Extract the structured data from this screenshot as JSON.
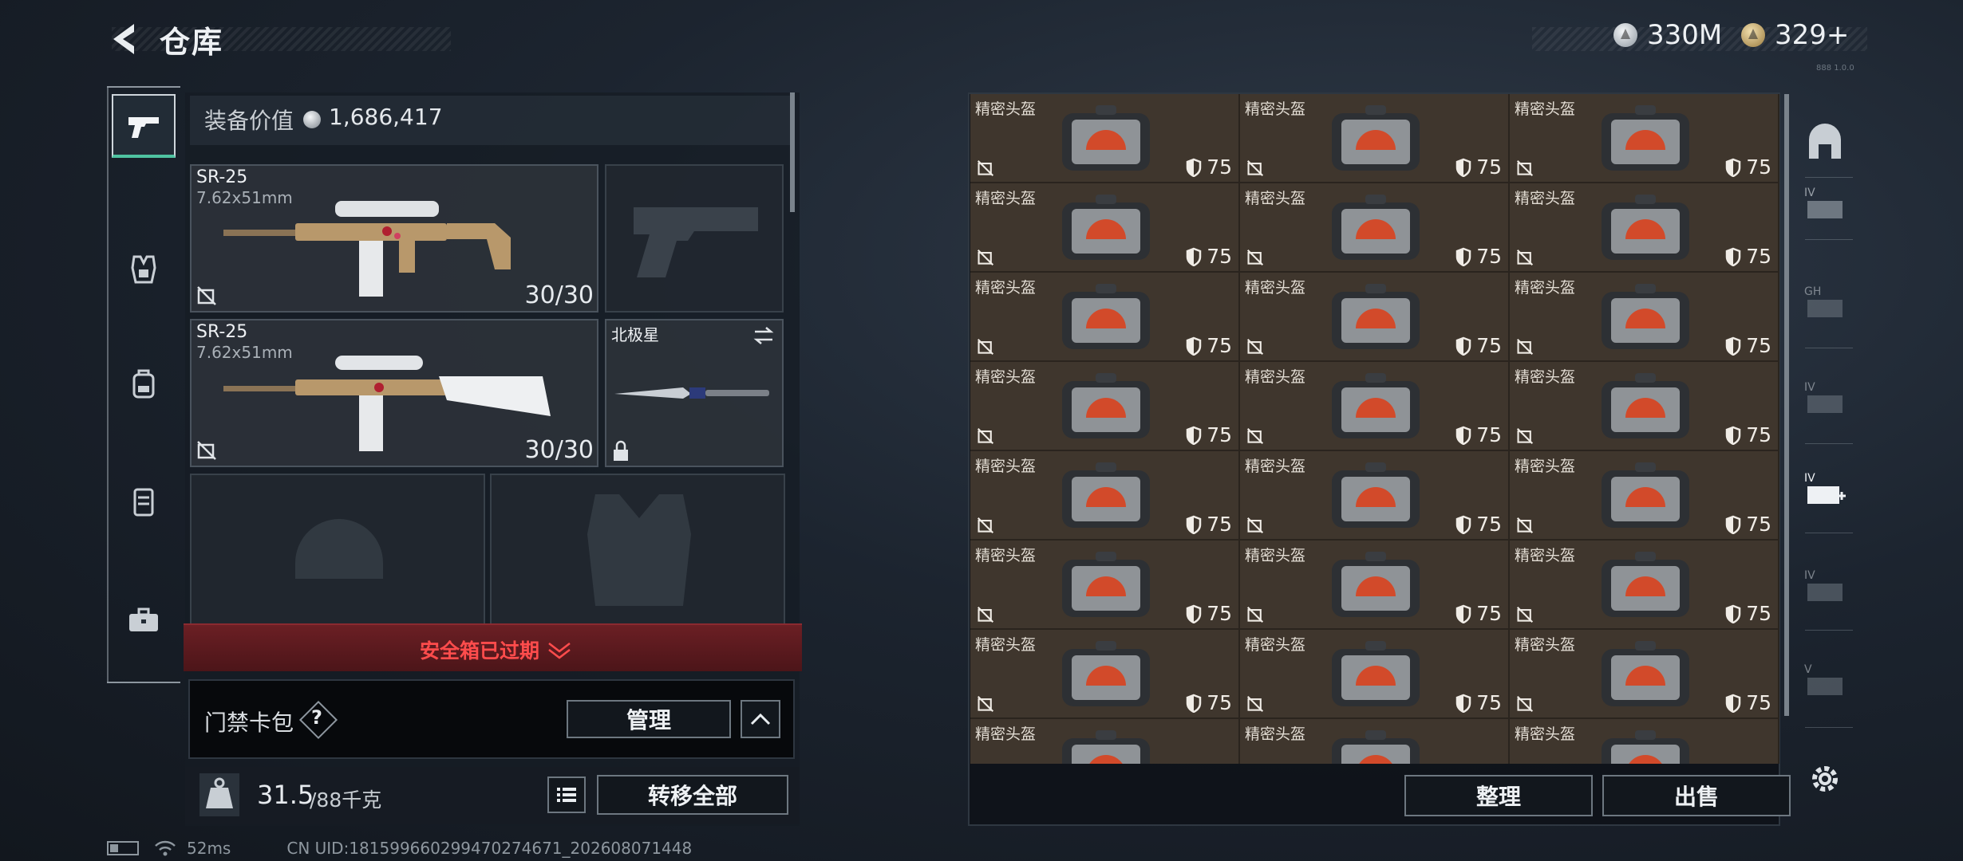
{
  "header": {
    "title": "仓库"
  },
  "currency": [
    {
      "icon": "silver-coin-icon",
      "value": "330M"
    },
    {
      "icon": "gold-coin-icon",
      "value": "329+"
    }
  ],
  "version": "888 1.0.0",
  "rail": [
    {
      "icon": "pistol-icon",
      "active": true
    },
    {
      "icon": "armor-vest-icon",
      "active": false
    },
    {
      "icon": "backpack-icon",
      "active": false
    },
    {
      "icon": "chest-rig-icon",
      "active": false
    },
    {
      "icon": "briefcase-icon",
      "active": false
    }
  ],
  "equipment": {
    "value_label": "装备价值",
    "value": "1,686,417",
    "primary1": {
      "name": "SR-25",
      "caliber": "7.62x51mm",
      "ammo": "30/30"
    },
    "primary2": {
      "name": "SR-25",
      "caliber": "7.62x51mm",
      "ammo": "30/30"
    },
    "melee": {
      "name": "北极星"
    }
  },
  "safe_box": {
    "text": "安全箱已过期"
  },
  "keycard": {
    "label": "门禁卡包",
    "help": "?",
    "manage": "管理"
  },
  "weight": {
    "current": "31.5",
    "max": "/88千克",
    "transfer_all": "转移全部"
  },
  "stash": {
    "item_name": "精密头盔",
    "durability": "75",
    "rows": 8,
    "cols": 3,
    "organize": "整理",
    "sell": "出售"
  },
  "status": {
    "ping": "52ms",
    "uid": "CN UID:18159966029947027467​1_202608071448"
  },
  "colors": {
    "accent": "#4fc3a1",
    "warning": "#ff4c4c",
    "cell_bg": "#3f362d"
  }
}
